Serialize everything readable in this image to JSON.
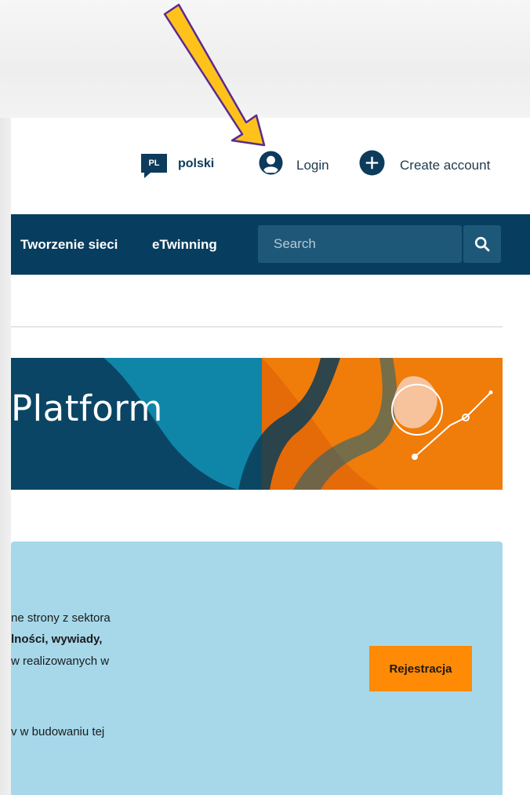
{
  "header": {
    "language": {
      "code": "PL",
      "label": "polski"
    },
    "login_label": "Login",
    "create_account_label": "Create account"
  },
  "nav": {
    "items": [
      {
        "label": "Tworzenie sieci"
      },
      {
        "label": "eTwinning"
      }
    ],
    "search": {
      "placeholder": "Search"
    }
  },
  "banner": {
    "title": "Platform"
  },
  "info": {
    "lines": [
      "ne strony z sektora",
      "lności, wywiady,",
      "w realizowanych w",
      "v w budowaniu tej"
    ],
    "register_label": "Rejestracja"
  },
  "colors": {
    "navy": "#073d5f",
    "search_bg": "#1e5878",
    "accent_orange": "#ff8a05",
    "info_bg": "#a6d8ea",
    "annotation_arrow": "#ffc21a"
  }
}
